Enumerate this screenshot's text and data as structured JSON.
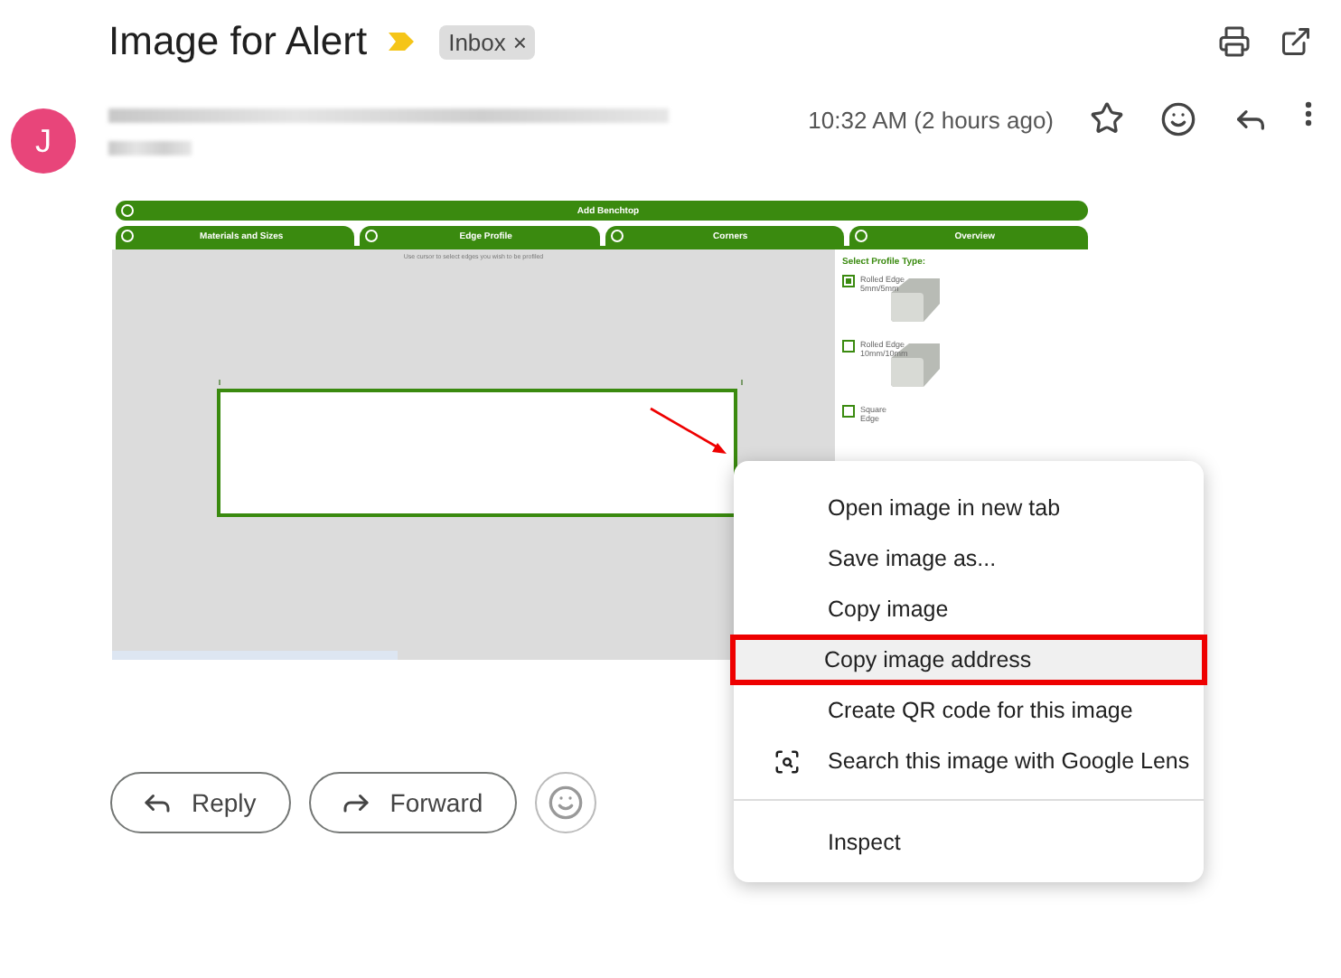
{
  "email": {
    "subject": "Image for Alert",
    "label": {
      "text": "Inbox",
      "remove": "×"
    },
    "avatar": "J",
    "time": "10:32 AM (2 hours ago)"
  },
  "image": {
    "top_bar": "Add Benchtop",
    "tabs": [
      {
        "label": "Materials and Sizes"
      },
      {
        "label": "Edge Profile"
      },
      {
        "label": "Corners"
      },
      {
        "label": "Overview"
      }
    ],
    "instruction": "Use cursor to select edges you wish to be profiled",
    "profile_title": "Select Profile Type:",
    "profiles": [
      {
        "label": "Rolled Edge 5mm/5mm",
        "checked": true,
        "kind": "pictured"
      },
      {
        "label": "Rolled Edge 10mm/10mm",
        "checked": false,
        "kind": "pictured"
      },
      {
        "label": "Square Edge",
        "checked": false,
        "kind": "plain"
      }
    ]
  },
  "context_menu": {
    "items": [
      {
        "label": "Open image in new tab",
        "selected": false,
        "kind": "plain"
      },
      {
        "label": "Save image as...",
        "selected": false,
        "kind": "plain"
      },
      {
        "label": "Copy image",
        "selected": false,
        "kind": "plain"
      },
      {
        "label": "Copy image address",
        "selected": true,
        "kind": "plain"
      },
      {
        "label": "Create QR code for this image",
        "selected": false,
        "kind": "plain"
      },
      {
        "label": "Search this image with Google Lens",
        "selected": false,
        "kind": "lens"
      }
    ],
    "footer_items": [
      {
        "label": "Inspect",
        "selected": false
      }
    ]
  },
  "actions": [
    "Reply",
    "Forward"
  ]
}
